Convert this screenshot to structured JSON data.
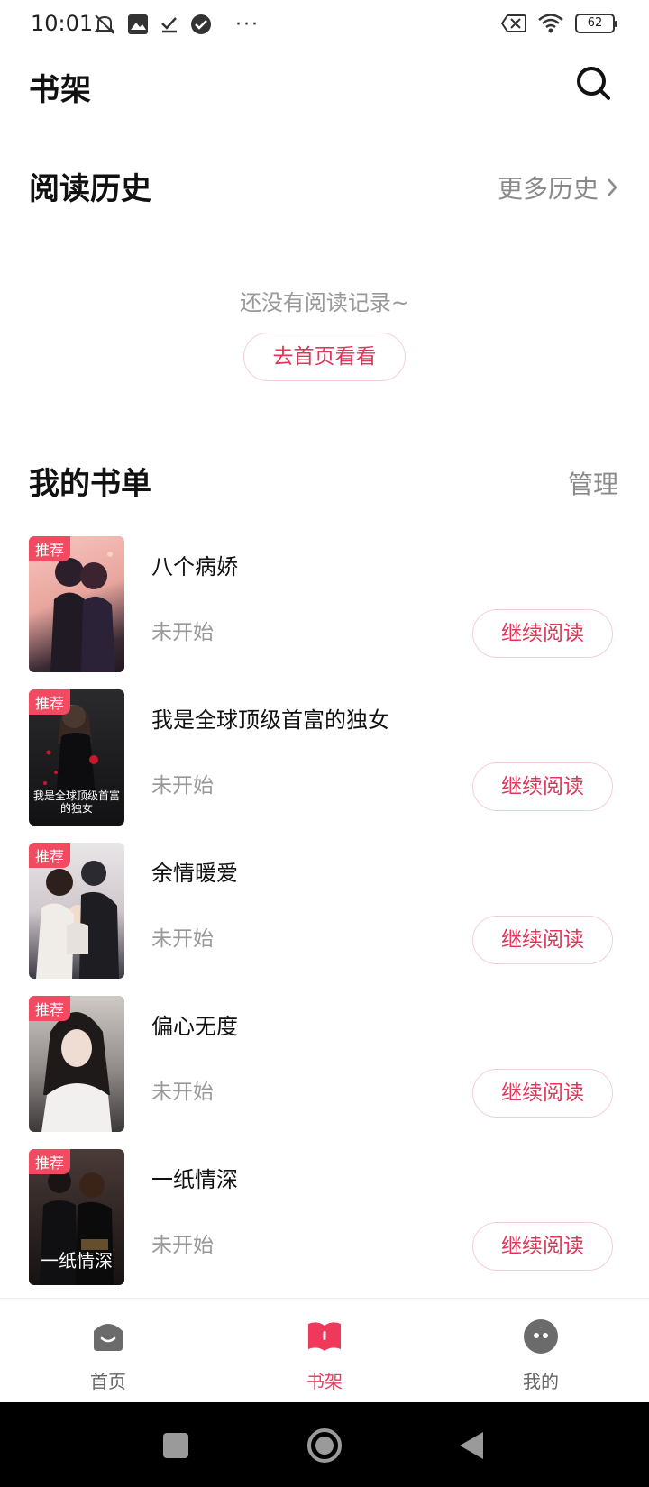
{
  "status_bar": {
    "time": "10:01",
    "more": "···",
    "battery": "62"
  },
  "header": {
    "title": "书架",
    "search_icon": "search-icon"
  },
  "history": {
    "title": "阅读历史",
    "more_link": "更多历史",
    "empty_text": "还没有阅读记录~",
    "go_home_button": "去首页看看"
  },
  "booklist": {
    "title": "我的书单",
    "manage": "管理",
    "books": [
      {
        "title": "八个病娇",
        "tag": "推荐",
        "status": "未开始",
        "button": "继续阅读",
        "cover_caption": ""
      },
      {
        "title": "我是全球顶级首富的独女",
        "tag": "推荐",
        "status": "未开始",
        "button": "继续阅读",
        "cover_caption": "我是全球顶级首富的独女"
      },
      {
        "title": "余情暖爱",
        "tag": "推荐",
        "status": "未开始",
        "button": "继续阅读",
        "cover_caption": ""
      },
      {
        "title": "偏心无度",
        "tag": "推荐",
        "status": "未开始",
        "button": "继续阅读",
        "cover_caption": ""
      },
      {
        "title": "一纸情深",
        "tag": "推荐",
        "status": "未开始",
        "button": "继续阅读",
        "cover_caption": "一纸情深"
      }
    ]
  },
  "tabs": [
    {
      "label": "首页",
      "icon": "home-icon",
      "active": false
    },
    {
      "label": "书架",
      "icon": "bookshelf-icon",
      "active": true
    },
    {
      "label": "我的",
      "icon": "profile-icon",
      "active": false
    }
  ],
  "colors": {
    "accent": "#e8415f",
    "tag": "#f24a61",
    "muted": "#999999"
  }
}
